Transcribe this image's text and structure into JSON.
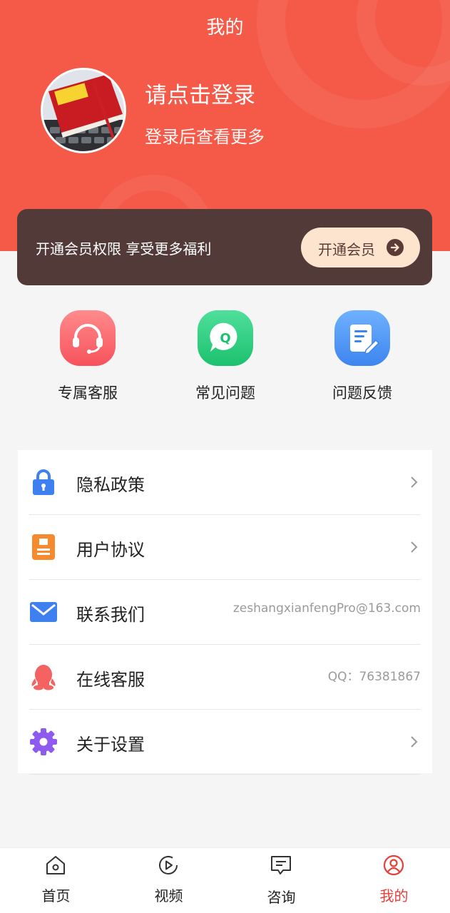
{
  "header": {
    "title": "我的",
    "login_title": "请点击登录",
    "login_subtitle": "登录后查看更多",
    "avatar_badge": "民法典"
  },
  "vip": {
    "text": "开通会员权限 享受更多福利",
    "button_label": "开通会员"
  },
  "quick_actions": [
    {
      "label": "专属客服",
      "icon": "headset-icon"
    },
    {
      "label": "常见问题",
      "icon": "faq-icon"
    },
    {
      "label": "问题反馈",
      "icon": "feedback-icon"
    }
  ],
  "menu": [
    {
      "label": "隐私政策",
      "icon": "lock-icon"
    },
    {
      "label": "用户协议",
      "icon": "document-icon"
    },
    {
      "label": "联系我们",
      "icon": "mail-icon",
      "value": "zeshangxianfengPro@163.com"
    },
    {
      "label": "在线客服",
      "icon": "qq-icon",
      "value": "QQ：76381867"
    },
    {
      "label": "关于设置",
      "icon": "gear-icon"
    }
  ],
  "tabs": [
    {
      "label": "首页",
      "icon": "home-icon"
    },
    {
      "label": "视频",
      "icon": "play-icon"
    },
    {
      "label": "咨询",
      "icon": "message-icon"
    },
    {
      "label": "我的",
      "icon": "user-icon",
      "active": true
    }
  ],
  "colors": {
    "primary": "#f55a49",
    "vip_bg": "#523a39",
    "vip_button": "#fde4cf",
    "active_tab": "#e5403a"
  }
}
